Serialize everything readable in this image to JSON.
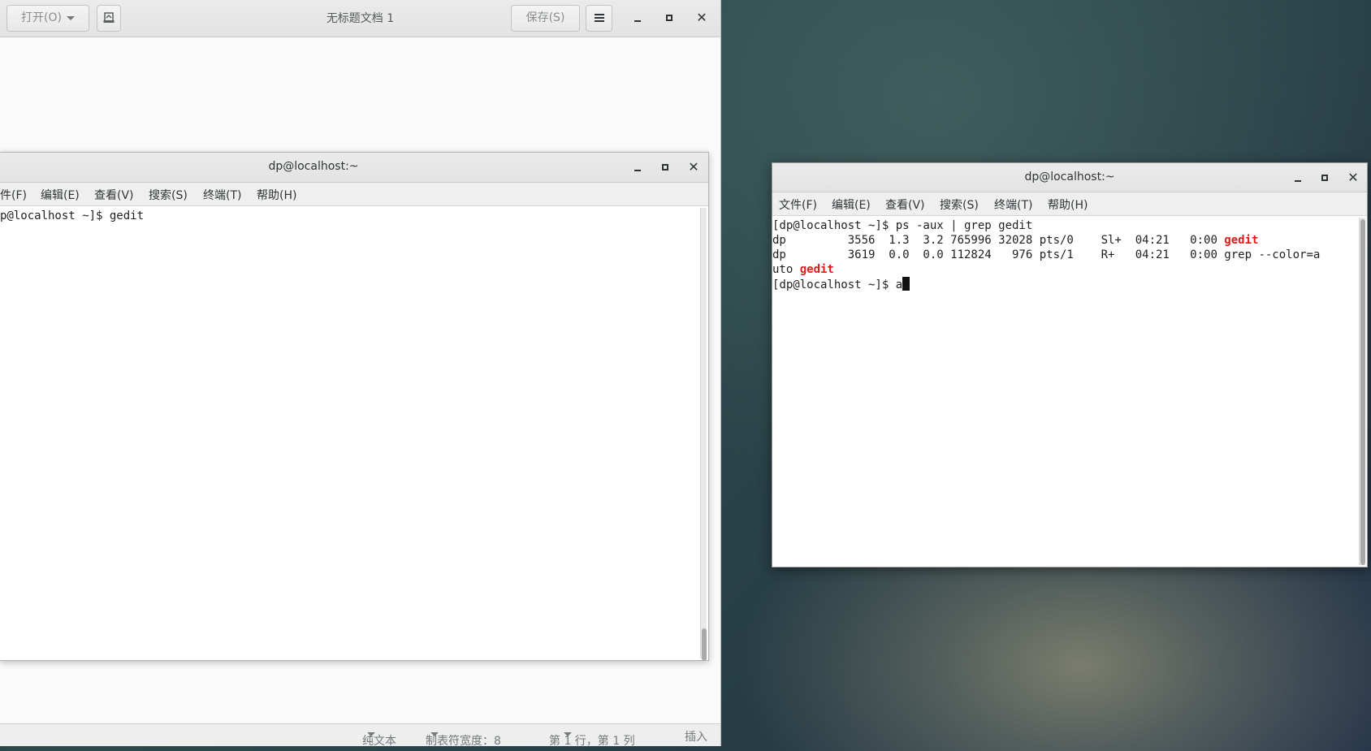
{
  "gedit": {
    "title": "无标题文档 1",
    "open_label": "打开(O)",
    "save_label": "保存(S)",
    "status": {
      "syntax": "纯文本",
      "tab_width": "制表符宽度：8",
      "position": "第 1 行，第 1 列",
      "mode": "插入"
    }
  },
  "terminal_left": {
    "title": "dp@localhost:~",
    "menu": [
      "件(F)",
      "编辑(E)",
      "查看(V)",
      "搜索(S)",
      "终端(T)",
      "帮助(H)"
    ],
    "lines": [
      "p@localhost ~]$ gedit"
    ]
  },
  "terminal_right": {
    "title": "dp@localhost:~",
    "menu": [
      "文件(F)",
      "编辑(E)",
      "查看(V)",
      "搜索(S)",
      "终端(T)",
      "帮助(H)"
    ],
    "line1": "[dp@localhost ~]$ ps -aux | grep gedit",
    "line2_pre": "dp         3556  1.3  3.2 765996 32028 pts/0    Sl+  04:21   0:00 ",
    "line2_hl": "gedit",
    "line3": "dp         3619  0.0  0.0 112824   976 pts/1    R+   04:21   0:00 grep --color=a",
    "line4_pre": "uto ",
    "line4_hl": "gedit",
    "line5": "[dp@localhost ~]$ a"
  },
  "colors": {
    "grep_highlight": "#e01b1b",
    "terminal_bg": "#ffffff",
    "titlebar_bg": "#e8e8e8"
  },
  "icons": {
    "window_minimize": "minimize-icon",
    "window_maximize": "maximize-icon",
    "window_close": "close-icon",
    "hamburger": "menu-icon",
    "new_tab": "new-document-icon"
  }
}
